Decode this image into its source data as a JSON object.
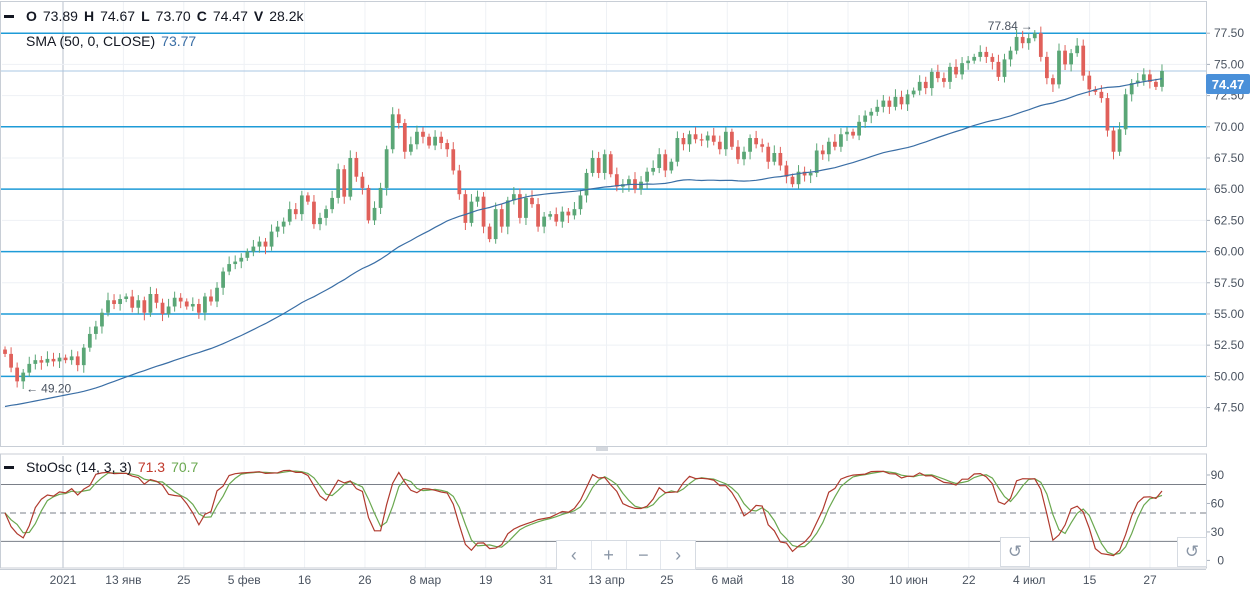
{
  "legend": {
    "ohlcv": [
      {
        "key": "O",
        "value": "73.89"
      },
      {
        "key": "H",
        "value": "74.67"
      },
      {
        "key": "L",
        "value": "73.70"
      },
      {
        "key": "C",
        "value": "74.47"
      },
      {
        "key": "V",
        "value": "28.2k"
      }
    ],
    "sma_label": "SMA (50, 0, CLOSE)",
    "sma_value": "73.77",
    "sto_label": "StoOsc (14, 3, 3)",
    "sto_k_value": "71.3",
    "sto_d_value": "70.7"
  },
  "last_price": "74.47",
  "nav": {
    "prev": "‹",
    "zoom_in": "+",
    "zoom_out": "−",
    "next": "›",
    "reset": "↺"
  },
  "chart_data": {
    "type": "candlestick",
    "price_axis": {
      "min": 44.5,
      "max": 80.0,
      "ticks": [
        "47.50",
        "50.00",
        "52.50",
        "55.00",
        "57.50",
        "60.00",
        "62.50",
        "65.00",
        "67.50",
        "70.00",
        "72.50",
        "75.00",
        "77.50"
      ]
    },
    "osc_axis": {
      "min": -8,
      "max": 110,
      "ticks": [
        "0",
        "30",
        "60",
        "90"
      ]
    },
    "time_axis": [
      "2021",
      "13 янв",
      "25",
      "5 фев",
      "16",
      "26",
      "8 мар",
      "19",
      "31",
      "13 апр",
      "25",
      "6 май",
      "18",
      "30",
      "10 июн",
      "22",
      "4 июл",
      "15",
      "27"
    ],
    "horizontal_levels": [
      50.0,
      55.0,
      60.0,
      65.0,
      70.0,
      77.5
    ],
    "annotations": [
      {
        "label": "77.84",
        "price": 77.84
      },
      {
        "label": "49.20",
        "price": 49.2
      }
    ],
    "close": [
      51.8,
      50.7,
      49.6,
      50.3,
      51.0,
      51.3,
      51.1,
      51.4,
      51.2,
      51.5,
      51.3,
      51.6,
      50.9,
      52.3,
      53.4,
      54.0,
      55.1,
      56.1,
      55.8,
      56.2,
      56.4,
      55.5,
      56.1,
      55.1,
      56.6,
      55.9,
      55.0,
      55.6,
      56.3,
      56.0,
      55.6,
      55.8,
      55.1,
      56.4,
      56.0,
      57.1,
      58.4,
      59.0,
      59.2,
      59.5,
      60.0,
      60.4,
      60.8,
      60.4,
      61.6,
      62.0,
      62.4,
      63.4,
      63.0,
      64.5,
      64.0,
      62.2,
      62.7,
      63.4,
      64.3,
      66.6,
      64.4,
      67.5,
      66.0,
      65.1,
      62.5,
      63.5,
      65.1,
      68.2,
      71.0,
      70.3,
      68.0,
      68.6,
      69.6,
      69.2,
      68.5,
      69.2,
      68.7,
      68.2,
      66.5,
      64.6,
      62.3,
      64.0,
      64.4,
      62.0,
      61.0,
      63.4,
      62.0,
      64.1,
      64.6,
      62.7,
      64.3,
      63.8,
      62.0,
      62.8,
      63.0,
      62.4,
      63.2,
      62.9,
      63.4,
      64.5,
      66.3,
      67.5,
      66.3,
      67.8,
      66.2,
      65.2,
      65.4,
      65.8,
      65.0,
      65.6,
      66.4,
      66.7,
      67.8,
      66.5,
      67.2,
      69.1,
      68.6,
      69.4,
      69.0,
      68.9,
      69.3,
      68.8,
      68.2,
      69.6,
      68.4,
      67.4,
      68.0,
      69.1,
      68.6,
      68.4,
      67.2,
      67.9,
      66.9,
      66.0,
      65.4,
      66.4,
      66.1,
      66.3,
      68.1,
      67.8,
      68.8,
      68.4,
      69.4,
      69.6,
      69.3,
      70.4,
      70.9,
      71.2,
      71.6,
      72.1,
      71.6,
      72.4,
      71.8,
      72.6,
      72.9,
      73.6,
      73.1,
      74.4,
      73.9,
      73.6,
      74.8,
      74.2,
      75.1,
      75.3,
      75.6,
      76.0,
      75.6,
      75.2,
      74.0,
      75.4,
      76.1,
      77.2,
      76.7,
      77.1,
      77.5,
      75.6,
      73.9,
      73.4,
      76.1,
      75.0,
      75.9,
      76.5,
      74.1,
      73.0,
      72.8,
      72.3,
      69.7,
      68.0,
      69.8,
      72.6,
      73.5,
      73.7,
      74.2,
      73.6,
      73.2,
      74.47
    ]
  }
}
